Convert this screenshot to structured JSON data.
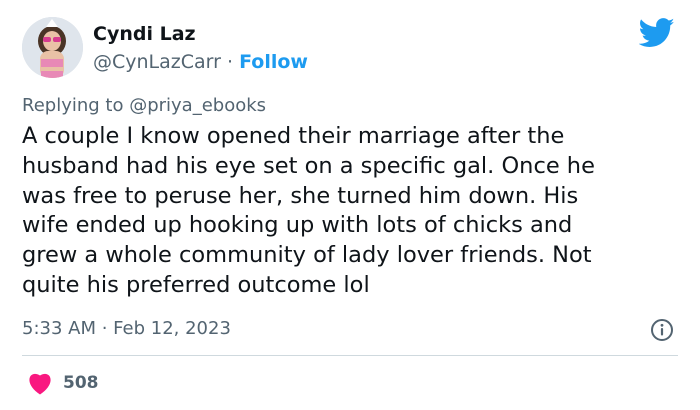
{
  "author": {
    "name": "Cyndi Laz",
    "handle": "@CynLazCarr",
    "separator": "·",
    "follow_label": "Follow"
  },
  "reply": {
    "prefix": "Replying to ",
    "mention": "@priya_ebooks"
  },
  "tweet": {
    "text": "A couple I know opened their marriage after the\nhusband had his eye set on a specific gal. Once he\nwas free to peruse her, she turned him down. His\nwife ended up hooking up with lots of chicks and\ngrew a whole community of lady lover friends. Not\nquite his preferred outcome lol",
    "timestamp": "5:33 AM · Feb 12, 2023"
  },
  "engagement": {
    "like_count": "508"
  },
  "icons": {
    "logo": "twitter-bird-icon",
    "info": "info-icon",
    "like": "heart-icon"
  },
  "colors": {
    "brand_blue": "#1d9bf0",
    "like_red": "#f91880",
    "secondary_text": "#536471",
    "primary_text": "#0f1419",
    "divider": "#cfd9de"
  }
}
